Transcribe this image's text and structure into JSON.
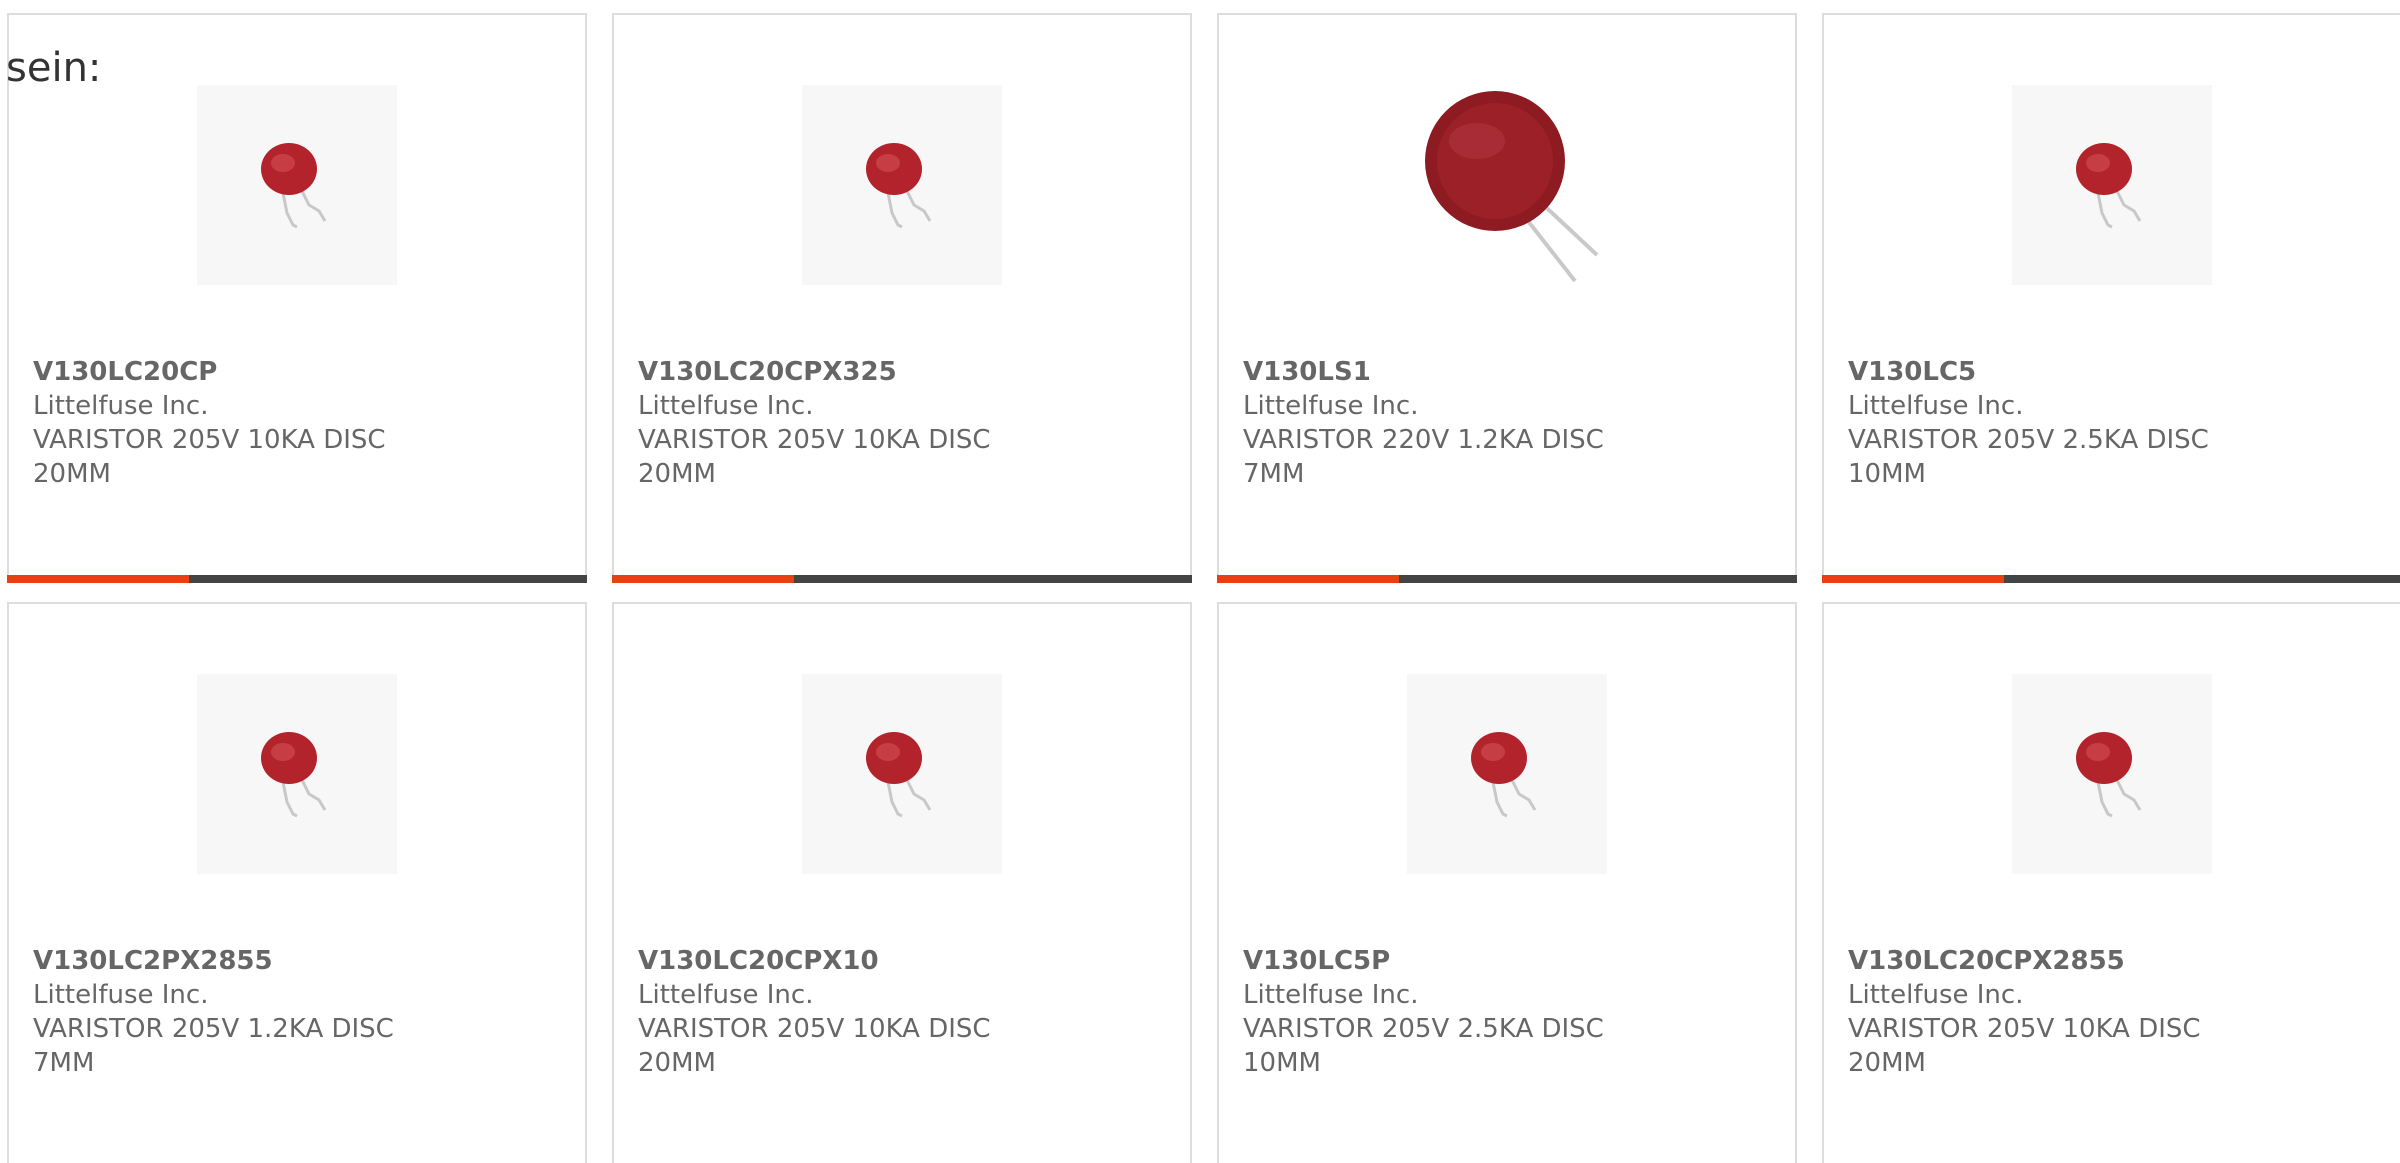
{
  "intro_text": "sein:",
  "colors": {
    "accent": "#e8410f",
    "bar": "#444444",
    "border": "#dddddd",
    "text": "#666666",
    "varistor_red": "#b3232b"
  },
  "products": [
    {
      "part": "V130LC20CP",
      "maker": "Littelfuse Inc.",
      "desc": "VARISTOR 205V 10KA DISC 20MM",
      "image_icon": "small-varistor-icon"
    },
    {
      "part": "V130LC20CPX325",
      "maker": "Littelfuse Inc.",
      "desc": "VARISTOR 205V 10KA DISC 20MM",
      "image_icon": "small-varistor-icon"
    },
    {
      "part": "V130LS1",
      "maker": "Littelfuse Inc.",
      "desc": "VARISTOR 220V 1.2KA DISC 7MM",
      "image_icon": "large-varistor-icon"
    },
    {
      "part": "V130LC5",
      "maker": "Littelfuse Inc.",
      "desc": "VARISTOR 205V 2.5KA DISC 10MM",
      "image_icon": "small-varistor-icon"
    },
    {
      "part": "V130LC2PX2855",
      "maker": "Littelfuse Inc.",
      "desc": "VARISTOR 205V 1.2KA DISC 7MM",
      "image_icon": "small-varistor-icon"
    },
    {
      "part": "V130LC20CPX10",
      "maker": "Littelfuse Inc.",
      "desc": "VARISTOR 205V 10KA DISC 20MM",
      "image_icon": "small-varistor-icon"
    },
    {
      "part": "V130LC5P",
      "maker": "Littelfuse Inc.",
      "desc": "VARISTOR 205V 2.5KA DISC 10MM",
      "image_icon": "small-varistor-icon"
    },
    {
      "part": "V130LC20CPX2855",
      "maker": "Littelfuse Inc.",
      "desc": "VARISTOR 205V 10KA DISC 20MM",
      "image_icon": "small-varistor-icon"
    }
  ]
}
